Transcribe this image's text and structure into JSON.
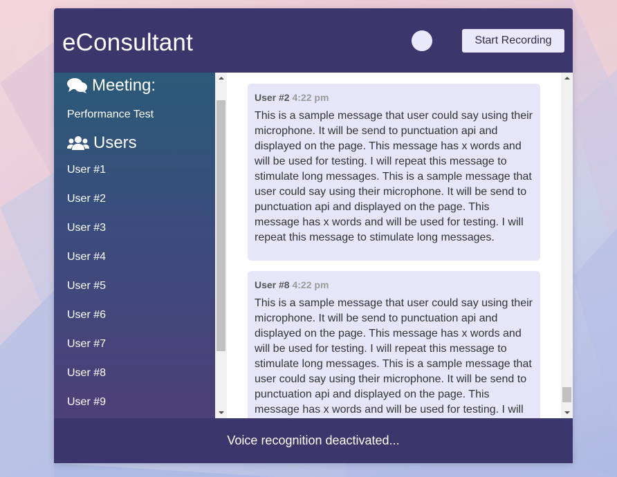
{
  "app": {
    "title": "eConsultant"
  },
  "header": {
    "record_button": "Start Recording"
  },
  "sidebar": {
    "meeting_heading": "Meeting:",
    "meeting_name": "Performance Test",
    "users_heading": "Users",
    "users": [
      "User #1",
      "User #2",
      "User #3",
      "User #4",
      "User #5",
      "User #6",
      "User #7",
      "User #8",
      "User #9"
    ]
  },
  "messages": [
    {
      "user": "User #2",
      "time": "4:22 pm",
      "text": "This is a sample message that user could say using their microphone. It will be send to punctuation api and displayed on the page. This message has x words and will be used for testing. I will repeat this message to stimulate long messages. This is a sample message that user could say using their microphone. It will be send to punctuation api and displayed on the page. This message has x words and will be used for testing. I will repeat this message to stimulate long messages."
    },
    {
      "user": "User #8",
      "time": "4:22 pm",
      "text": "This is a sample message that user could say using their microphone. It will be send to punctuation api and displayed on the page. This message has x words and will be used for testing. I will repeat this message to stimulate long messages. This is a sample message that user could say using their microphone. It will be send to punctuation api and displayed on the page. This message has x words and will be used for testing. I will repeat this message to stimulate long messages."
    }
  ],
  "footer": {
    "status": "Voice recognition deactivated..."
  },
  "icons": {
    "meeting": "comments-icon",
    "users": "users-icon"
  }
}
